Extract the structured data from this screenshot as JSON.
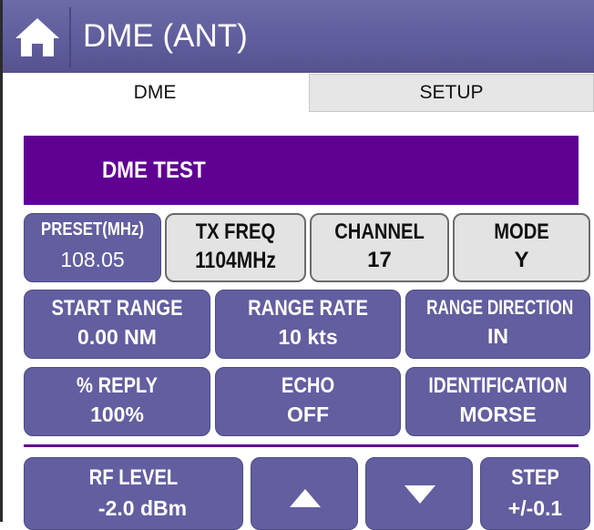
{
  "window": {
    "title": "DME (ANT)"
  },
  "tabs": [
    {
      "label": "DME",
      "selected": true
    },
    {
      "label": "SETUP",
      "selected": false
    }
  ],
  "banner": {
    "label": "DME TEST"
  },
  "row1": [
    {
      "label": "PRESET(MHz)",
      "value": "108.05"
    },
    {
      "label": "TX FREQ",
      "value": "1104MHz"
    },
    {
      "label": "CHANNEL",
      "value": "17"
    },
    {
      "label": "MODE",
      "value": "Y"
    }
  ],
  "row2": [
    {
      "label": "START RANGE",
      "value": "0.00 NM"
    },
    {
      "label": "RANGE RATE",
      "value": "10 kts"
    },
    {
      "label": "RANGE DIRECTION",
      "value": "IN"
    }
  ],
  "row3": [
    {
      "label": "% REPLY",
      "value": "100%"
    },
    {
      "label": "ECHO",
      "value": "OFF"
    },
    {
      "label": "IDENTIFICATION",
      "value": "MORSE"
    }
  ],
  "row4": {
    "rf_level": {
      "label": "RF LEVEL",
      "value": "-2.0 dBm"
    },
    "up": {
      "icon": "triangle-up-icon"
    },
    "down": {
      "icon": "triangle-down-icon"
    },
    "step": {
      "label": "STEP",
      "value": "+/-0.1"
    }
  },
  "colors": {
    "header": "#5f5c9c",
    "banner": "#600093",
    "button": "#625ea0",
    "grey_button": "#e3e3e3"
  }
}
